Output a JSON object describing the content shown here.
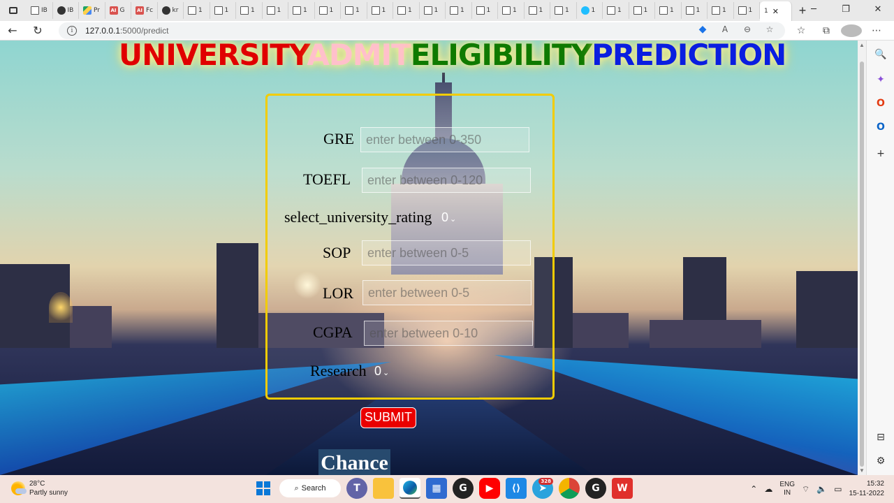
{
  "browser": {
    "tabs": [
      {
        "icon": "page",
        "label": "IB"
      },
      {
        "icon": "github",
        "label": "IB"
      },
      {
        "icon": "drive",
        "label": "Pr"
      },
      {
        "icon": "ai",
        "label": "G"
      },
      {
        "icon": "ai",
        "label": "Fc"
      },
      {
        "icon": "github",
        "label": "kr"
      },
      {
        "icon": "page",
        "label": "1"
      },
      {
        "icon": "page",
        "label": "1"
      },
      {
        "icon": "page",
        "label": "1"
      },
      {
        "icon": "page",
        "label": "1"
      },
      {
        "icon": "page",
        "label": "1"
      },
      {
        "icon": "page",
        "label": "1"
      },
      {
        "icon": "page",
        "label": "1"
      },
      {
        "icon": "page",
        "label": "1"
      },
      {
        "icon": "page",
        "label": "1"
      },
      {
        "icon": "page",
        "label": "1"
      },
      {
        "icon": "page",
        "label": "1"
      },
      {
        "icon": "page",
        "label": "1"
      },
      {
        "icon": "page",
        "label": "1"
      },
      {
        "icon": "page",
        "label": "1"
      },
      {
        "icon": "page",
        "label": "1"
      },
      {
        "icon": "kaggle",
        "label": "1"
      },
      {
        "icon": "page",
        "label": "1"
      },
      {
        "icon": "page",
        "label": "1"
      },
      {
        "icon": "page",
        "label": "1"
      },
      {
        "icon": "page",
        "label": "1"
      },
      {
        "icon": "page",
        "label": "1"
      },
      {
        "icon": "page",
        "label": "1"
      }
    ],
    "active_tab_label": "1",
    "close_glyph": "✕",
    "new_tab_glyph": "+",
    "window_controls": {
      "minimize": "─",
      "maximize": "❐",
      "close": "✕"
    },
    "nav": {
      "back": "←",
      "reload": "↻"
    },
    "url_host": "127.0.0.1",
    "url_path": ":5000/predict",
    "omnibox_icons": [
      "tag-icon",
      "read-aloud-icon",
      "zoom-icon",
      "favorite-add-icon"
    ],
    "omnibox_glyphs": {
      "tag": "◆",
      "read": "A",
      "zoom": "⊖",
      "fav": "☆"
    },
    "toolbar_glyphs": {
      "favorites": "☆",
      "collections": "⧉",
      "menu": "⋯"
    }
  },
  "page": {
    "title_parts": [
      {
        "text": "UNIVERSITY",
        "color": "#e00000"
      },
      {
        "text": "ADMIT",
        "color": "#ffc0cb"
      },
      {
        "text": "ELIGIBILITY",
        "color": "#0f7a00"
      },
      {
        "text": "PREDICTION",
        "color": "#0a1ee0"
      }
    ],
    "form": {
      "gre_label": "GRE",
      "gre_placeholder": "enter between 0-350",
      "toefl_label": "TOEFL",
      "toefl_placeholder": "enter between 0-120",
      "rating_label": "select_university_rating",
      "rating_value": "0",
      "sop_label": "SOP",
      "sop_placeholder": "enter between 0-5",
      "lor_label": "LOR",
      "lor_placeholder": "enter between 0-5",
      "cgpa_label": "CGPA",
      "cgpa_placeholder": "enter between 0-10",
      "research_label": "Research",
      "research_value": "0"
    },
    "submit_label": "SUBMIT",
    "result_label": "Chance"
  },
  "edge_sidebar": {
    "search": "🔍",
    "copilot": "✦",
    "office": "O",
    "outlook": "O",
    "add": "+",
    "panel": "⊟",
    "settings": "⚙"
  },
  "taskbar": {
    "weather_temp": "28°C",
    "weather_desc": "Partly sunny",
    "search_label": "Search",
    "apps": [
      "start-icon",
      "search",
      "teams-icon",
      "file-explorer-icon",
      "edge-icon",
      "store-icon",
      "github-desktop-icon",
      "youtube-icon",
      "vscode-icon",
      "telegram-icon",
      "chrome-icon",
      "github-icon",
      "wps-icon"
    ],
    "telegram_badge": "328",
    "lang_line1": "ENG",
    "lang_line2": "IN",
    "time": "15:32",
    "date": "15-11-2022"
  }
}
